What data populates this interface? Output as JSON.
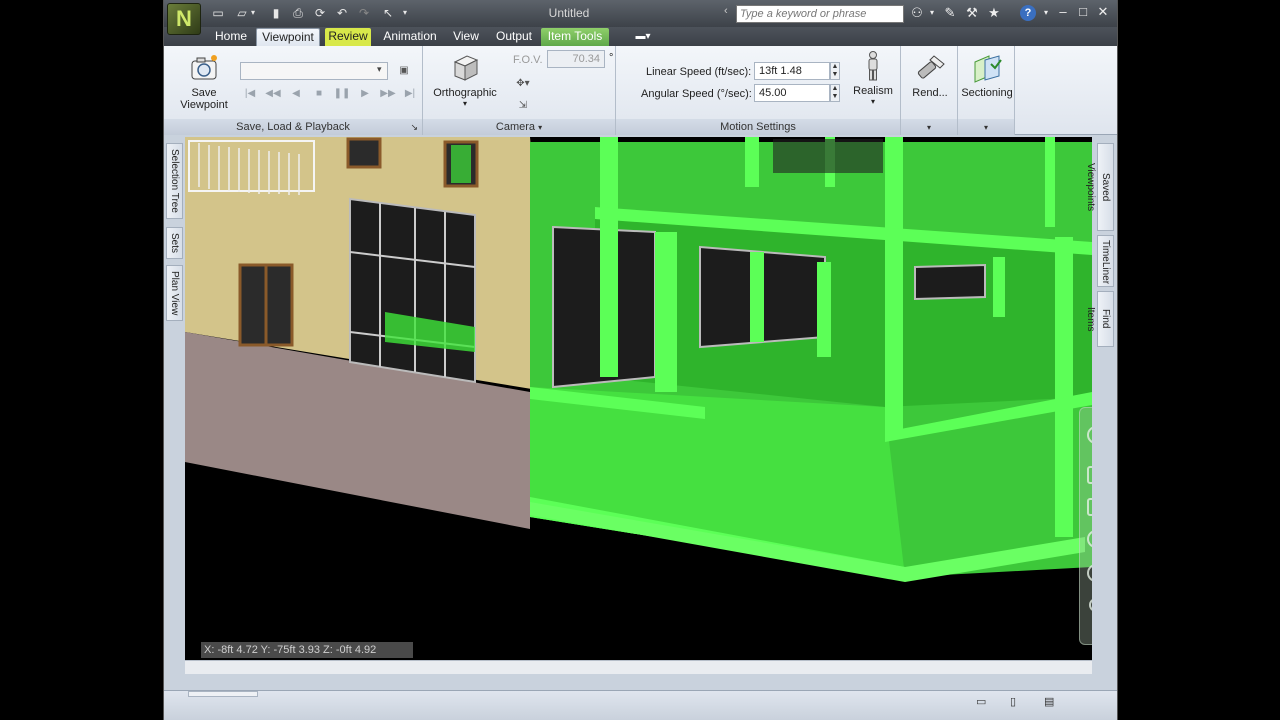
{
  "window": {
    "title": "Untitled",
    "search_placeholder": "Type a keyword or phrase"
  },
  "tabs": [
    {
      "label": "Home"
    },
    {
      "label": "Viewpoint"
    },
    {
      "label": "Review"
    },
    {
      "label": "Animation"
    },
    {
      "label": "View"
    },
    {
      "label": "Output"
    },
    {
      "label": "Item Tools"
    }
  ],
  "ribbon": {
    "save_viewpoint": {
      "line1": "Save",
      "line2": "Viewpoint"
    },
    "save_load_playback": {
      "title": "Save, Load & Playback",
      "combo_value": ""
    },
    "camera": {
      "title": "Camera",
      "projection_label": "Orthographic",
      "fov_label": "F.O.V.",
      "fov_value": "70.34",
      "fov_unit": "°"
    },
    "motion": {
      "title": "Motion Settings",
      "linear_label": "Linear Speed (ft/sec):",
      "linear_value": "13ft 1.48",
      "angular_label": "Angular Speed (°/sec):",
      "angular_value": "45.00",
      "realism_label": "Realism"
    },
    "render_label": "Rend...",
    "sectioning_label": "Sectioning"
  },
  "side_tabs": {
    "left": [
      "Selection Tree",
      "Sets",
      "Plan View"
    ],
    "right": [
      "Saved Viewpoints",
      "TimeLiner",
      "Find Items"
    ]
  },
  "coordinates": "X: -8ft 4.72  Y: -75ft 3.93  Z: -0ft 4.92",
  "colors": {
    "selection_green": "#3fe63a",
    "facade": "#d3c48a",
    "base_wall": "#9a8886",
    "review_tab": "#d8e84a"
  },
  "icons": {
    "logo": "N",
    "help": "?"
  }
}
